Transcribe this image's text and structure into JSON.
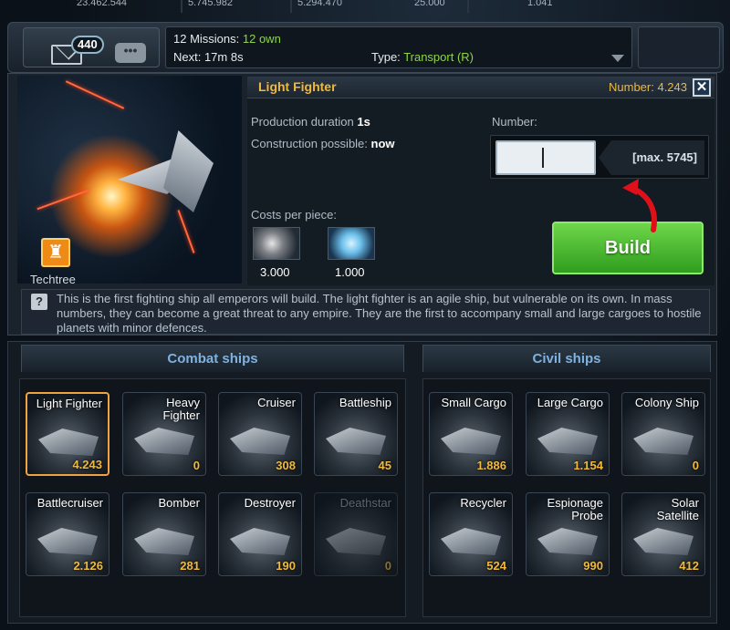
{
  "resources": [
    "23.462.544",
    "5.745.982",
    "5.294.470",
    "25.000",
    "1.041"
  ],
  "header": {
    "mail_count": "440",
    "chat_glyph": "•••",
    "missions_text": "12 Missions: ",
    "missions_own": "12 own",
    "next_label": "Next: 17m 8s",
    "type_label": "Type: ",
    "type_value": "Transport (R)"
  },
  "detail": {
    "title": "Light Fighter",
    "number_owned": "Number: 4.243",
    "close_glyph": "✕",
    "production_label": "Production duration",
    "production_value": "1s",
    "construction_label": "Construction possible:",
    "construction_value": "now",
    "number_label": "Number:",
    "number_input_value": "",
    "max_label": "[max. 5745]",
    "costs_label": "Costs per piece:",
    "cost_metal": "3.000",
    "cost_crystal": "1.000",
    "build_label": "Build",
    "techtree_label": "Techtree",
    "help_glyph": "?",
    "description": "This is the first fighting ship all emperors will build. The light fighter is an agile ship, but vulnerable on its own. In mass numbers, they can become a great threat to any empire. They are the first to accompany small and large cargoes to hostile planets with minor defences."
  },
  "sections": {
    "combat_title": "Combat ships",
    "civil_title": "Civil ships"
  },
  "combat_ships": [
    {
      "name": "Light Fighter",
      "count": "4.243",
      "selected": true
    },
    {
      "name": "Heavy Fighter",
      "count": "0"
    },
    {
      "name": "Cruiser",
      "count": "308"
    },
    {
      "name": "Battleship",
      "count": "45"
    },
    {
      "name": "Battlecruiser",
      "count": "2.126"
    },
    {
      "name": "Bomber",
      "count": "281"
    },
    {
      "name": "Destroyer",
      "count": "190"
    },
    {
      "name": "Deathstar",
      "count": "0",
      "locked": true
    }
  ],
  "civil_ships": [
    {
      "name": "Small Cargo",
      "count": "1.886"
    },
    {
      "name": "Large Cargo",
      "count": "1.154"
    },
    {
      "name": "Colony Ship",
      "count": "0"
    },
    {
      "name": "Recycler",
      "count": "524"
    },
    {
      "name": "Espionage Probe",
      "count": "990"
    },
    {
      "name": "Solar Satellite",
      "count": "412"
    }
  ],
  "colors": {
    "accent_gold": "#f0b93a",
    "build_green": "#4cc23a",
    "section_blue": "#7fb2e0",
    "annotation_red": "#e0101a"
  }
}
